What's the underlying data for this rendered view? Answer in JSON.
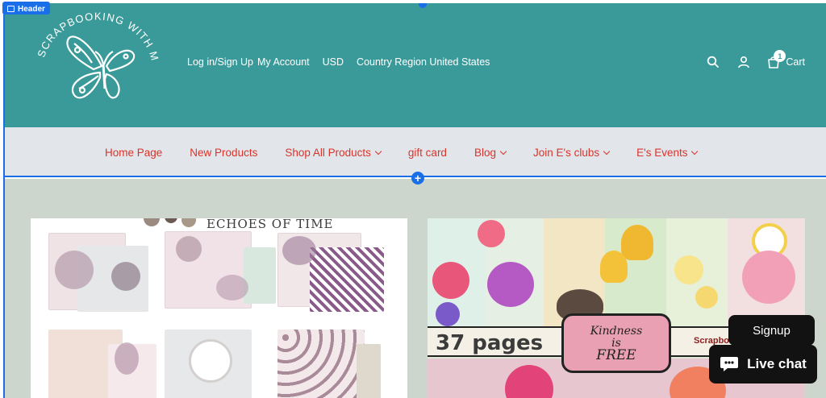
{
  "editor": {
    "section_badge": "Header"
  },
  "logo": {
    "text": "SCRAPBOOKING WITH ME"
  },
  "utility": {
    "login": "Log in/Sign Up",
    "account": "My Account",
    "currency": "USD",
    "country": "Country Region United States"
  },
  "icons": {
    "search": "search-icon",
    "account": "user-icon",
    "cart": "cart-icon"
  },
  "cart": {
    "label": "Cart",
    "count": "1"
  },
  "nav": {
    "items": [
      {
        "label": "Home Page",
        "dropdown": false
      },
      {
        "label": "New Products",
        "dropdown": false
      },
      {
        "label": "Shop All Products",
        "dropdown": true
      },
      {
        "label": "gift card",
        "dropdown": false
      },
      {
        "label": "Blog",
        "dropdown": true
      },
      {
        "label": "Join E's clubs",
        "dropdown": true
      },
      {
        "label": "E's Events",
        "dropdown": true
      }
    ]
  },
  "products": {
    "left": {
      "title": "ECHOES OF TIME"
    },
    "right": {
      "pages": "37 pages",
      "label_line1": "Kindness",
      "label_line2": "is",
      "label_line3": "FREE",
      "brand": "Scrapbo"
    }
  },
  "chat": {
    "signup": "Signup",
    "live": "Live chat"
  },
  "colors": {
    "header_bg": "#3a9a9a",
    "nav_bg": "#e2e6ea",
    "nav_text": "#d9342b",
    "editor_accent": "#1a6fe8",
    "content_bg": "#cdd6cc"
  }
}
